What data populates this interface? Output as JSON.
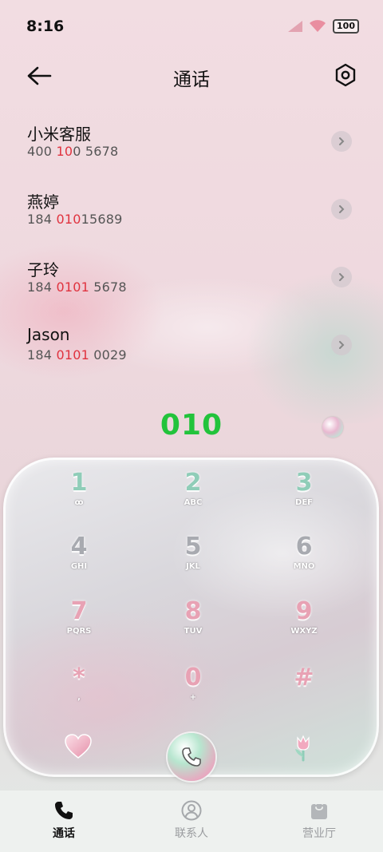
{
  "status_bar": {
    "time": "8:16",
    "battery": "100"
  },
  "header": {
    "title": "通话"
  },
  "contacts": [
    {
      "name": "小米客服",
      "number_parts": [
        "400 ",
        "10",
        "0 5678"
      ]
    },
    {
      "name": "燕婷",
      "number_parts": [
        "184 ",
        "010",
        "15689"
      ]
    },
    {
      "name": "子玲",
      "number_parts": [
        "184 ",
        "0101",
        " 5678"
      ]
    },
    {
      "name": "Jason",
      "number_parts": [
        "184 ",
        "0101",
        " 0029"
      ]
    }
  ],
  "dialer": {
    "input": "010",
    "keys": [
      {
        "digit": "1",
        "letters": "ꝏ"
      },
      {
        "digit": "2",
        "letters": "ABC"
      },
      {
        "digit": "3",
        "letters": "DEF"
      },
      {
        "digit": "4",
        "letters": "GHI"
      },
      {
        "digit": "5",
        "letters": "JKL"
      },
      {
        "digit": "6",
        "letters": "MNO"
      },
      {
        "digit": "7",
        "letters": "PQRS"
      },
      {
        "digit": "8",
        "letters": "TUV"
      },
      {
        "digit": "9",
        "letters": "WXYZ"
      },
      {
        "digit": "*",
        "letters": ","
      },
      {
        "digit": "0",
        "letters": "+"
      },
      {
        "digit": "#",
        "letters": ""
      }
    ]
  },
  "bottom_nav": [
    {
      "label": "通话",
      "icon": "phone-icon",
      "active": true
    },
    {
      "label": "联系人",
      "icon": "person-icon",
      "active": false
    },
    {
      "label": "营业厅",
      "icon": "shopping-bag-icon",
      "active": false
    }
  ],
  "colors": {
    "highlight": "#e0333f",
    "dial_text": "#22c33b",
    "key_green": "#8fcdb8",
    "key_grey": "#a8aab0",
    "key_pink": "#e8a2b4"
  }
}
